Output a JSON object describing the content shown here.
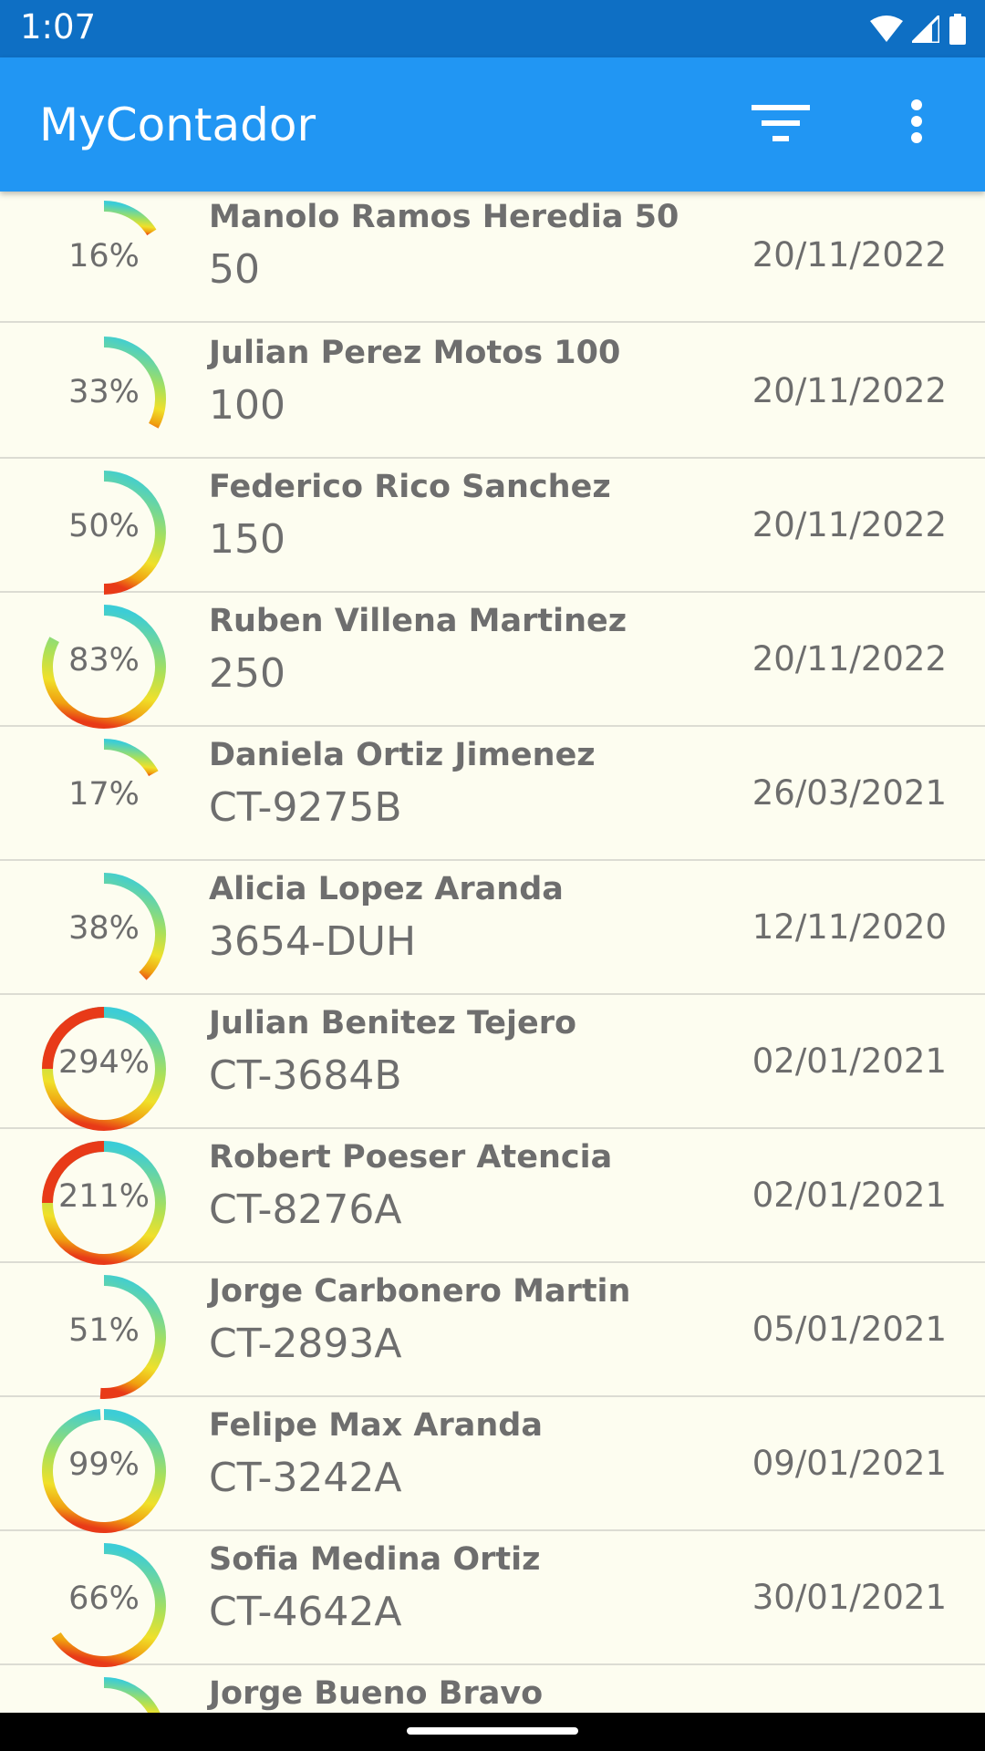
{
  "status_bar": {
    "time": "1:07"
  },
  "app_bar": {
    "title": "MyContador",
    "filter_icon": "filter-icon",
    "more_icon": "more-vert-icon"
  },
  "colors": {
    "status_bar": "#0e6fc4",
    "app_bar": "#2196f3",
    "background": "#fdfdf0"
  },
  "records": [
    {
      "percent_label": "16%",
      "progress": 16,
      "name": "Manolo Ramos Heredia 50",
      "plate": "50",
      "date": "20/11/2022"
    },
    {
      "percent_label": "33%",
      "progress": 33,
      "name": "Julian Perez Motos 100",
      "plate": "100",
      "date": "20/11/2022"
    },
    {
      "percent_label": "50%",
      "progress": 50,
      "name": "Federico Rico Sanchez",
      "plate": "150",
      "date": "20/11/2022"
    },
    {
      "percent_label": "83%",
      "progress": 83,
      "name": "Ruben Villena Martinez",
      "plate": "250",
      "date": "20/11/2022"
    },
    {
      "percent_label": "17%",
      "progress": 17,
      "name": "Daniela Ortiz Jimenez",
      "plate": "CT-9275B",
      "date": "26/03/2021"
    },
    {
      "percent_label": "38%",
      "progress": 38,
      "name": "Alicia Lopez Aranda",
      "plate": "3654-DUH",
      "date": "12/11/2020"
    },
    {
      "percent_label": "294%",
      "progress": 294,
      "name": "Julian Benitez Tejero",
      "plate": "CT-3684B",
      "date": "02/01/2021"
    },
    {
      "percent_label": "211%",
      "progress": 211,
      "name": "Robert Poeser Atencia",
      "plate": "CT-8276A",
      "date": "02/01/2021"
    },
    {
      "percent_label": "51%",
      "progress": 51,
      "name": "Jorge Carbonero Martin",
      "plate": "CT-2893A",
      "date": "05/01/2021"
    },
    {
      "percent_label": "99%",
      "progress": 99,
      "name": "Felipe Max Aranda",
      "plate": "CT-3242A",
      "date": "09/01/2021"
    },
    {
      "percent_label": "66%",
      "progress": 66,
      "name": "Sofia Medina Ortiz",
      "plate": "CT-4642A",
      "date": "30/01/2021"
    },
    {
      "percent_label": "",
      "progress": 20,
      "name": "Jorge Bueno Bravo",
      "plate": "",
      "date": ""
    }
  ]
}
